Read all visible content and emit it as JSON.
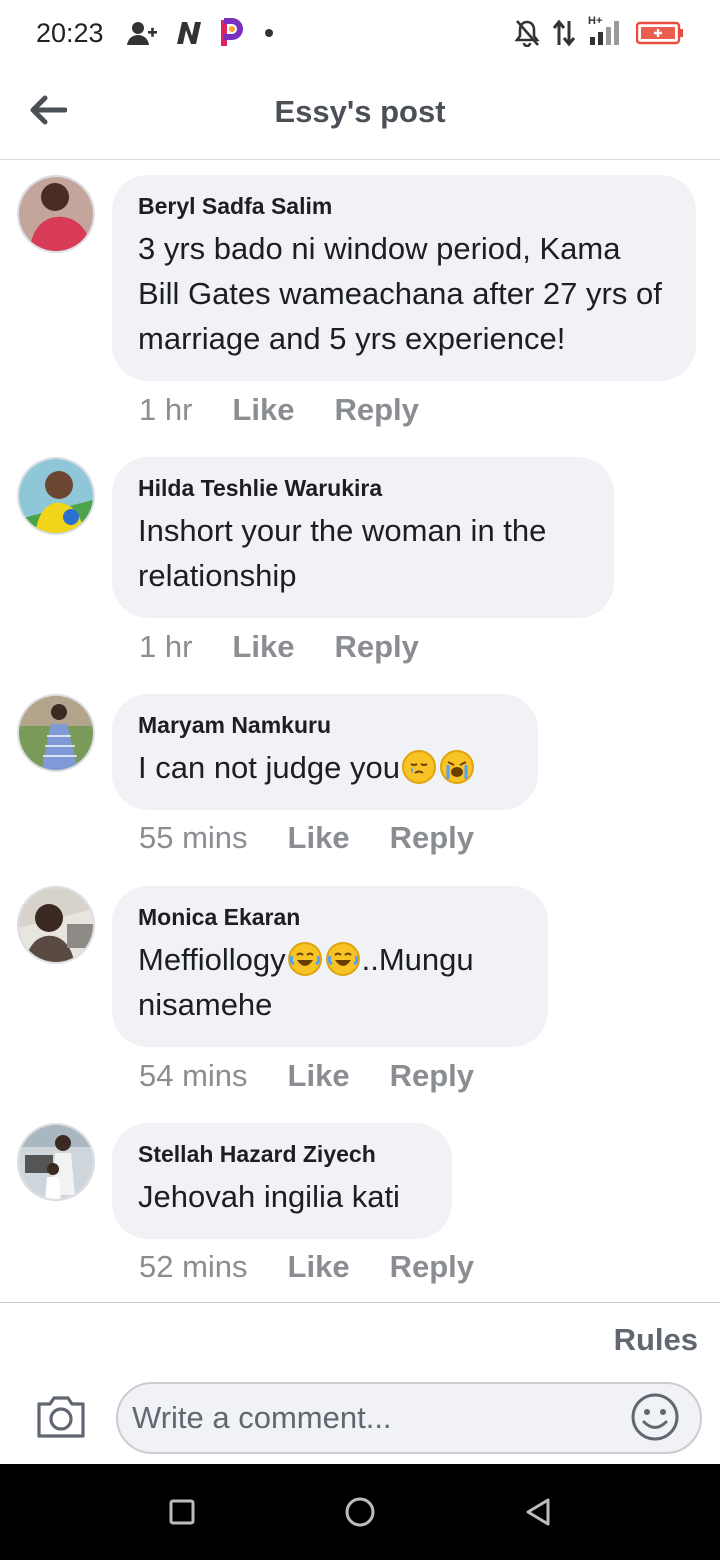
{
  "status_bar": {
    "time": "20:23",
    "left_icons": [
      "add-contact-icon",
      "n-app-icon",
      "p-app-icon",
      "dot-icon"
    ],
    "right_icons": [
      "mute-bell-icon",
      "data-arrows-icon",
      "signal-icon",
      "battery-icon"
    ],
    "network_label": "H+",
    "battery_color": "#e94b3c"
  },
  "header": {
    "title": "Essy's post"
  },
  "comments": [
    {
      "author": "Beryl Sadfa Salim",
      "text": "3 yrs bado ni window period, Kama Bill Gates wameachana after 27 yrs of marriage and 5 yrs experience!",
      "time": "1 hr",
      "like": "Like",
      "reply": "Reply"
    },
    {
      "author": "Hilda Teshlie Warukira",
      "text": "Inshort your the woman in the relationship",
      "time": "1 hr",
      "like": "Like",
      "reply": "Reply"
    },
    {
      "author": "Maryam Namkuru",
      "text": "I can not judge you",
      "emojis": [
        "sleepy-face-emoji",
        "loudly-crying-face-emoji"
      ],
      "time": "55 mins",
      "like": "Like",
      "reply": "Reply"
    },
    {
      "author": "Monica Ekaran",
      "text_before": "Meffiollogy",
      "emojis": [
        "tears-of-joy-emoji",
        "tears-of-joy-emoji"
      ],
      "text_after": "..Mungu",
      "text_line2": "nisamehe",
      "time": "54 mins",
      "like": "Like",
      "reply": "Reply"
    },
    {
      "author": "Stellah Hazard Ziyech",
      "text": "Jehovah ingilia kati",
      "time": "52 mins",
      "like": "Like",
      "reply": "Reply"
    }
  ],
  "rules_label": "Rules",
  "composer": {
    "placeholder": "Write a comment..."
  },
  "colors": {
    "bubble": "#f0f2f5",
    "meta_text": "#8a8d91",
    "header_text": "#4b4f56"
  },
  "nav_bar": {
    "buttons": [
      "recents-square-icon",
      "home-circle-icon",
      "back-triangle-icon"
    ]
  }
}
